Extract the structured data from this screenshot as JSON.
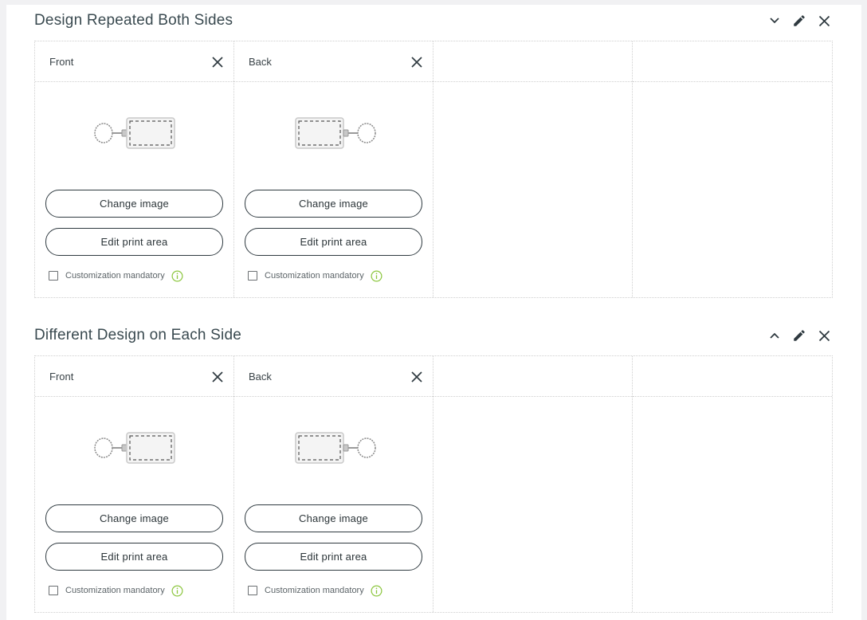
{
  "sections": [
    {
      "title": "Design Repeated Both Sides",
      "toggle_icon": "chevron-down-icon",
      "sides": [
        {
          "label": "Front",
          "thumb_orientation": "ring-left",
          "change_image_label": "Change image",
          "edit_print_area_label": "Edit print area",
          "mandatory_label": "Customization mandatory",
          "mandatory_checked": false
        },
        {
          "label": "Back",
          "thumb_orientation": "ring-right",
          "change_image_label": "Change image",
          "edit_print_area_label": "Edit print area",
          "mandatory_label": "Customization mandatory",
          "mandatory_checked": false
        }
      ]
    },
    {
      "title": "Different Design on Each Side",
      "toggle_icon": "chevron-up-icon",
      "sides": [
        {
          "label": "Front",
          "thumb_orientation": "ring-left",
          "change_image_label": "Change image",
          "edit_print_area_label": "Edit print area",
          "mandatory_label": "Customization mandatory",
          "mandatory_checked": false
        },
        {
          "label": "Back",
          "thumb_orientation": "ring-right",
          "change_image_label": "Change image",
          "edit_print_area_label": "Edit print area",
          "mandatory_label": "Customization mandatory",
          "mandatory_checked": false
        }
      ]
    }
  ],
  "colors": {
    "text": "#2f3a40",
    "info_icon": "#8cc63f",
    "page_background": "#f1f1f3"
  }
}
